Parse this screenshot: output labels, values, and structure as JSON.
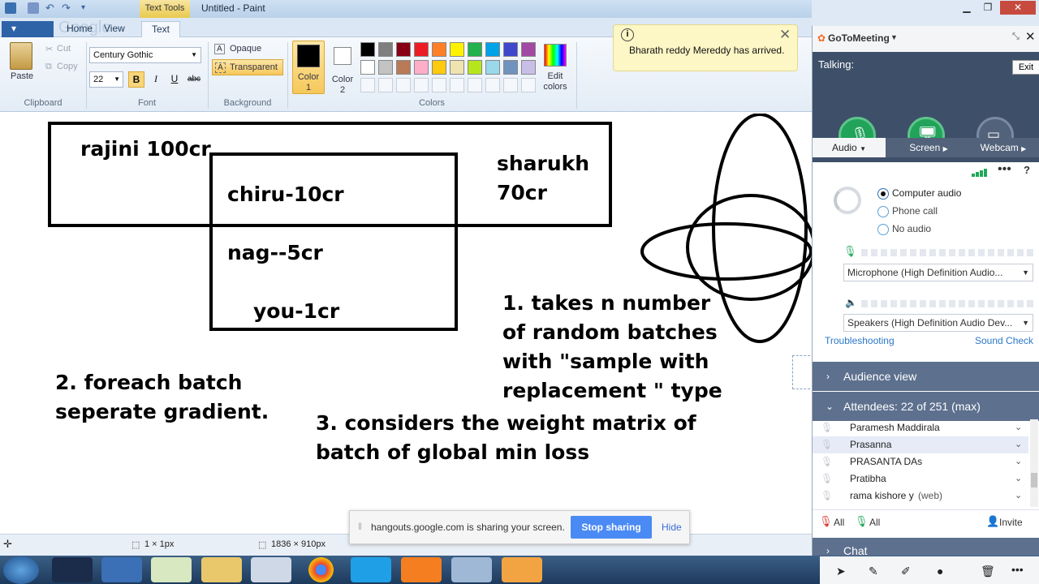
{
  "paint": {
    "title": "Untitled - Paint",
    "context_tab": "Text Tools",
    "tabs": [
      "Home",
      "View",
      "Text"
    ],
    "ghost_text": "Google",
    "clipboard": {
      "paste": "Paste",
      "cut": "Cut",
      "copy": "Copy",
      "label": "Clipboard"
    },
    "font": {
      "family": "Century Gothic",
      "size": "22",
      "bold": "B",
      "italic": "I",
      "underline": "U",
      "strike": "abc",
      "label": "Font"
    },
    "background": {
      "opaque": "Opaque",
      "transparent": "Transparent",
      "label": "Background"
    },
    "colors": {
      "color1_a": "Color",
      "color1_b": "1",
      "color2_a": "Color",
      "color2_b": "2",
      "edit_a": "Edit",
      "edit_b": "colors",
      "label": "Colors",
      "row1": [
        "#000000",
        "#7f7f7f",
        "#880015",
        "#ed1c24",
        "#ff7f27",
        "#fff200",
        "#22b14c",
        "#00a2e8",
        "#3f48cc",
        "#a349a4"
      ],
      "row2": [
        "#ffffff",
        "#c3c3c3",
        "#b97a57",
        "#ffaec9",
        "#ffc90e",
        "#efe4b0",
        "#b5e61d",
        "#99d9ea",
        "#7092be",
        "#c8bfe7"
      ]
    },
    "canvas_text": {
      "rajini": "rajini 100cr",
      "chiru": "chiru-10cr",
      "sharukh_1": "sharukh",
      "sharukh_2": "70cr",
      "nag": "nag--5cr",
      "you": "you-1cr",
      "step1_l1": "1. takes n number",
      "step1_l2": "of random batches",
      "step1_l3": "with \"sample with",
      "step1_l4": "replacement \" type",
      "step2_l1": "2. foreach batch",
      "step2_l2": "seperate gradient.",
      "step3_l1": "3. considers the weight matrix of",
      "step3_l2": "batch of global min loss"
    },
    "status": {
      "selection": "1 × 1px",
      "canvas_size": "1836 × 910px"
    }
  },
  "share_bar": {
    "message": "hangouts.google.com is sharing your screen.",
    "stop": "Stop sharing",
    "hide": "Hide"
  },
  "notification": {
    "text": "Bharath reddy Mereddy has arrived."
  },
  "gotomeeting": {
    "brand": "GoToMeeting",
    "exit_tooltip": "Exit",
    "talking": "Talking:",
    "tabs": {
      "audio": "Audio",
      "screen": "Screen",
      "webcam": "Webcam"
    },
    "audio_options": [
      "Computer audio",
      "Phone call",
      "No audio"
    ],
    "microphone": "Microphone (High Definition Audio...",
    "speakers": "Speakers (High Definition Audio Dev...",
    "troubleshooting": "Troubleshooting",
    "sound_check": "Sound Check",
    "audience_view": "Audience view",
    "attendees_header": "Attendees:  22 of 251 (max)",
    "attendees": [
      {
        "name": "Paramesh Maddirala",
        "suffix": ""
      },
      {
        "name": "Prasanna",
        "suffix": ""
      },
      {
        "name": "PRASANTA DAs",
        "suffix": ""
      },
      {
        "name": "Pratibha",
        "suffix": ""
      },
      {
        "name": "rama kishore y",
        "suffix": "(web)"
      }
    ],
    "all_muted": "All",
    "all_unmuted": "All",
    "invite": "Invite",
    "chat": "Chat"
  }
}
